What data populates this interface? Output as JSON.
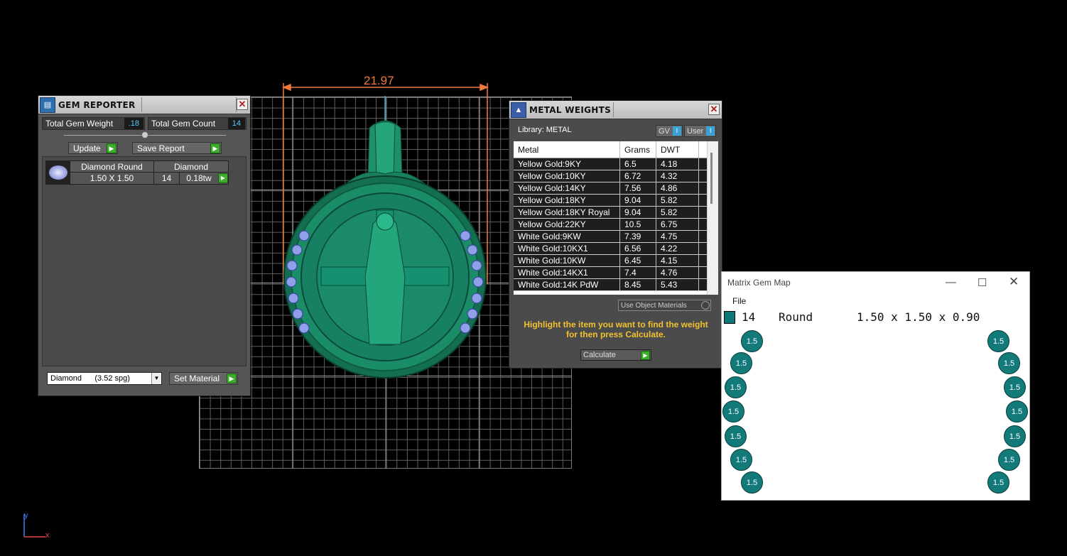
{
  "viewport": {
    "dimension_label": "21.97",
    "axis_y": "y",
    "axis_x": "x"
  },
  "gem_reporter": {
    "title": "GEM REPORTER",
    "icon": "gem-report-icon",
    "total_weight_label": "Total Gem Weight",
    "total_weight_value": ".18",
    "total_count_label": "Total Gem Count",
    "total_count_value": "14",
    "update_label": "Update",
    "save_report_label": "Save Report",
    "row": {
      "name_header": "Diamond Round",
      "type_header": "Diamond",
      "size": "1.50 X 1.50",
      "count": "14",
      "weight": "0.18tw"
    },
    "material_select": "Diamond      (3.52 spg)",
    "set_material_label": "Set Material"
  },
  "metal_weights": {
    "title": "METAL WEIGHTS",
    "library_label": "Library: METAL",
    "gv_label": "GV",
    "user_label": "User",
    "columns": [
      "Metal",
      "Grams",
      "DWT"
    ],
    "rows": [
      [
        "Yellow Gold:9KY",
        "6.5",
        "4.18"
      ],
      [
        "Yellow Gold:10KY",
        "6.72",
        "4.32"
      ],
      [
        "Yellow Gold:14KY",
        "7.56",
        "4.86"
      ],
      [
        "Yellow Gold:18KY",
        "9.04",
        "5.82"
      ],
      [
        "Yellow Gold:18KY Royal",
        "9.04",
        "5.82"
      ],
      [
        "Yellow Gold:22KY",
        "10.5",
        "6.75"
      ],
      [
        "White Gold:9KW",
        "7.39",
        "4.75"
      ],
      [
        "White Gold:10KX1",
        "6.56",
        "4.22"
      ],
      [
        "White Gold:10KW",
        "6.45",
        "4.15"
      ],
      [
        "White Gold:14KX1",
        "7.4",
        "4.76"
      ],
      [
        "White Gold:14K PdW",
        "8.45",
        "5.43"
      ]
    ],
    "use_object_materials": "Use Object Materials",
    "hint": "Highlight the item you want to find the weight for then press Calculate.",
    "calculate_label": "Calculate"
  },
  "gem_map": {
    "title": "Matrix Gem Map",
    "menu_file": "File",
    "count": "14",
    "shape": "Round",
    "dims": "1.50 x 1.50 x 0.90",
    "swatch_color": "#0e7777",
    "gem_label": "1.5"
  }
}
